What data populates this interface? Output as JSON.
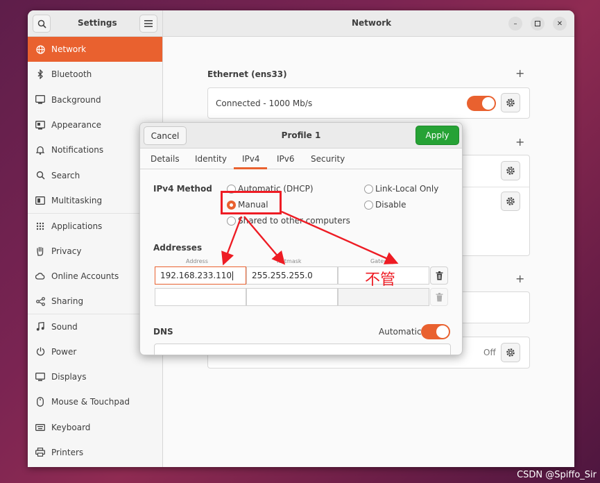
{
  "sidebar_header": {
    "title": "Settings"
  },
  "main_header": {
    "title": "Network"
  },
  "sidebar": {
    "items": [
      {
        "label": "Network",
        "icon": "network-icon",
        "active": true
      },
      {
        "label": "Bluetooth",
        "icon": "bluetooth-icon"
      },
      {
        "label": "Background",
        "icon": "background-icon"
      },
      {
        "label": "Appearance",
        "icon": "appearance-icon"
      },
      {
        "label": "Notifications",
        "icon": "bell-icon"
      },
      {
        "label": "Search",
        "icon": "search-icon"
      },
      {
        "label": "Multitasking",
        "icon": "multitasking-icon"
      },
      {
        "label": "Applications",
        "icon": "applications-icon"
      },
      {
        "label": "Privacy",
        "icon": "privacy-hand-icon"
      },
      {
        "label": "Online Accounts",
        "icon": "cloud-icon"
      },
      {
        "label": "Sharing",
        "icon": "share-icon"
      },
      {
        "label": "Sound",
        "icon": "music-note-icon"
      },
      {
        "label": "Power",
        "icon": "power-icon"
      },
      {
        "label": "Displays",
        "icon": "display-icon"
      },
      {
        "label": "Mouse & Touchpad",
        "icon": "mouse-icon"
      },
      {
        "label": "Keyboard",
        "icon": "keyboard-icon"
      },
      {
        "label": "Printers",
        "icon": "printer-icon"
      }
    ]
  },
  "network": {
    "ethernet_title": "Ethernet (ens33)",
    "ethernet_status": "Connected - 1000 Mb/s",
    "proxy_state": "Off"
  },
  "dialog": {
    "cancel_label": "Cancel",
    "title": "Profile 1",
    "apply_label": "Apply",
    "tabs": [
      "Details",
      "Identity",
      "IPv4",
      "IPv6",
      "Security"
    ],
    "active_tab": "IPv4",
    "ipv4_method_label": "IPv4 Method",
    "methods": {
      "automatic": "Automatic (DHCP)",
      "link_local": "Link-Local Only",
      "manual": "Manual",
      "disable": "Disable",
      "shared": "Shared to other computers"
    },
    "selected_method": "Manual",
    "addresses_label": "Addresses",
    "columns": [
      "Address",
      "Netmask",
      "Gateway"
    ],
    "address_value": "192.168.233.110",
    "netmask_value": "255.255.255.0",
    "gateway_value": "",
    "dns_label": "DNS",
    "dns_automatic_label": "Automatic"
  },
  "annotation": {
    "text": "不管"
  },
  "watermark": "CSDN @Spiffo_Sir",
  "colors": {
    "accent": "#e9612f",
    "apply": "#26a235",
    "annotation": "#ee1c24"
  }
}
